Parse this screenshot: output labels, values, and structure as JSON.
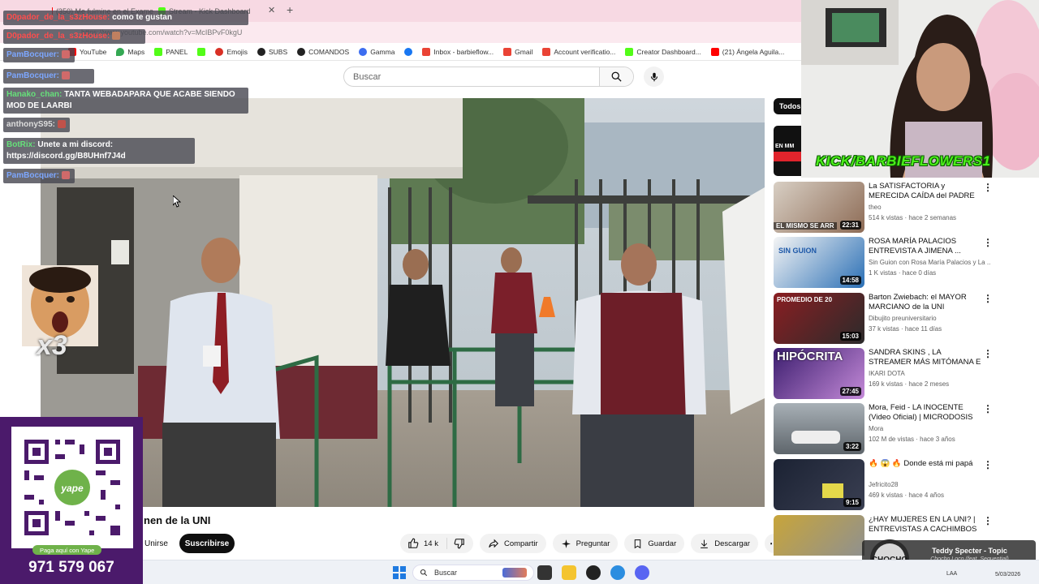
{
  "browser": {
    "tabs": [
      {
        "title": "(350) Me fulmine en el Exame"
      },
      {
        "title": "Stream - Kick Dashboard"
      }
    ],
    "address": "https://www.youtube.com/watch?v=McIBPvF0kgU",
    "bookmarks": [
      {
        "label": "YouTube",
        "color": "#ff0000"
      },
      {
        "label": "Maps",
        "color": "#34a853"
      },
      {
        "label": "PANEL",
        "color": "#53fc18"
      },
      {
        "label": "Emojis",
        "color": "#d93025"
      },
      {
        "label": "SUBS",
        "color": "#222222"
      },
      {
        "label": "COMANDOS",
        "color": "#222222"
      },
      {
        "label": "Gamma",
        "color": "#3c6df0"
      },
      {
        "label": "",
        "color": "#1877f2"
      },
      {
        "label": "Inbox - barbieflow...",
        "color": "#ea4335"
      },
      {
        "label": "Gmail",
        "color": "#ea4335"
      },
      {
        "label": "Account verificatio...",
        "color": "#ea4335"
      },
      {
        "label": "Creator Dashboard...",
        "color": "#53fc18"
      },
      {
        "label": "(21) Ángela Aguila...",
        "color": "#ff0000"
      }
    ]
  },
  "youtube": {
    "search_placeholder": "Buscar",
    "video_title": "nen de la UNI",
    "join_label": "Unirse",
    "subscribe_label": "Suscribirse",
    "likes": "14 k",
    "share_label": "Compartir",
    "ask_label": "Preguntar",
    "save_label": "Guardar",
    "download_label": "Descargar",
    "chip_label": "Todos",
    "recommendations": [
      {
        "title": "La SATISFACTORIA y MERECIDA CAÍDA del PADRE ...",
        "channel": "theo",
        "meta": "514 k vistas · hace 2 semanas",
        "duration": "22:31",
        "thumb_text": "EL MISMO SE ARR"
      },
      {
        "title": "ROSA MARÍA PALACIOS ENTREVISTA A JIMENA ...",
        "channel": "Sin Guion con Rosa María Palacios y La ...",
        "meta": "1 K vistas · hace 0 días",
        "duration": "14:58",
        "thumb_text": "SIN GUION"
      },
      {
        "title": "Barton Zwiebach: el MAYOR MARCIANO de la UNI",
        "channel": "Dibujito preuniversitario",
        "meta": "37 k vistas · hace 11 días",
        "duration": "15:03",
        "thumb_text": "PROMEDIO DE 20"
      },
      {
        "title": "SANDRA SKINS , LA STREAMER MÁS MITÓMANA E HIPÓCRIT...",
        "channel": "IKARI DOTA",
        "meta": "169 k vistas · hace 2 meses",
        "duration": "27:45",
        "thumb_text": "HIPÓCRITA"
      },
      {
        "title": "Mora, Feid - LA INOCENTE (Video Oficial) | MICRODOSIS",
        "channel": "Mora",
        "meta": "102 M de vistas · hace 3 años",
        "duration": "3:22",
        "thumb_text": ""
      },
      {
        "title": "🔥 😱 🔥 Donde está mi papá",
        "channel": "Jefricito28",
        "meta": "469 k vistas · hace 4 años",
        "duration": "9:15",
        "thumb_text": ""
      },
      {
        "title": "¿HAY MUJERES EN LA UNI? | ENTREVISTAS A CACHIMBOS",
        "channel": "",
        "meta": "",
        "duration": "",
        "thumb_text": ""
      }
    ]
  },
  "chat": [
    {
      "user": "D0pador_de_la_s3zHouse:",
      "text": "como te gustan",
      "color": "#ff4d4d"
    },
    {
      "user": "D0pador_de_la_s3zHouse:",
      "text": "",
      "color": "#ff4d4d"
    },
    {
      "user": "PamBocquer:",
      "text": "",
      "color": "#7da7ff"
    },
    {
      "user": "PamBocquer:",
      "text": "",
      "color": "#7da7ff"
    },
    {
      "user": "Hanako_chan:",
      "text": "TANTA WEBADAPARA QUE ACABE SIENDO MOD DE LAARBI",
      "color": "#66e07a"
    },
    {
      "user": "anthonyS95:",
      "text": "",
      "color": "#dddddd"
    },
    {
      "user": "BotRix:",
      "text": "Unete a mi discord: https://discord.gg/B8UHnf7J4d",
      "color": "#66e07a"
    },
    {
      "user": "PamBocquer:",
      "text": "",
      "color": "#7da7ff"
    }
  ],
  "stream": {
    "handle": "KICK/BARBIEFLOWERS1",
    "emote_multiplier": "x3",
    "donate_note": "Paga aquí con Yape",
    "donate_phone": "971 579 067"
  },
  "now_playing": {
    "title": "Teddy Specter - Topic",
    "subtitle": "Chocho Loco (feat. Sequential)",
    "logo_text": "CHOCHO"
  },
  "taskbar": {
    "search_label": "Buscar",
    "lang": "LAA",
    "date": "5/03/2026"
  }
}
